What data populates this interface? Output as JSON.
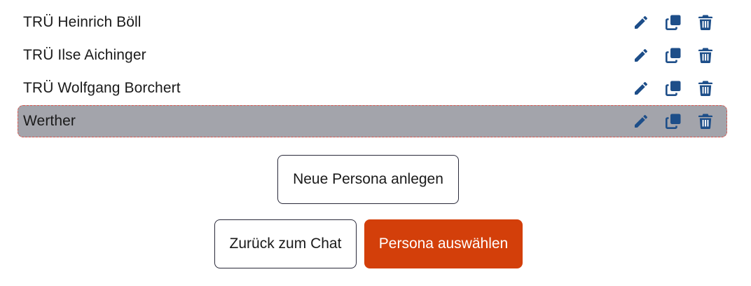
{
  "personas": [
    {
      "label": "TRÜ Heinrich Böll",
      "selected": false
    },
    {
      "label": "TRÜ Ilse Aichinger",
      "selected": false
    },
    {
      "label": "TRÜ Wolfgang Borchert",
      "selected": false
    },
    {
      "label": "Werther",
      "selected": true
    }
  ],
  "row_icons": [
    "pencil-icon",
    "copy-icon",
    "trash-icon"
  ],
  "buttons": {
    "new_persona": "Neue Persona anlegen",
    "back_to_chat": "Zurück zum Chat",
    "select_persona": "Persona auswählen"
  },
  "colors": {
    "icon": "#1d4e89",
    "primary": "#d33f0a",
    "selected_row": "#a3a4ab",
    "selected_border": "#d9544d"
  }
}
